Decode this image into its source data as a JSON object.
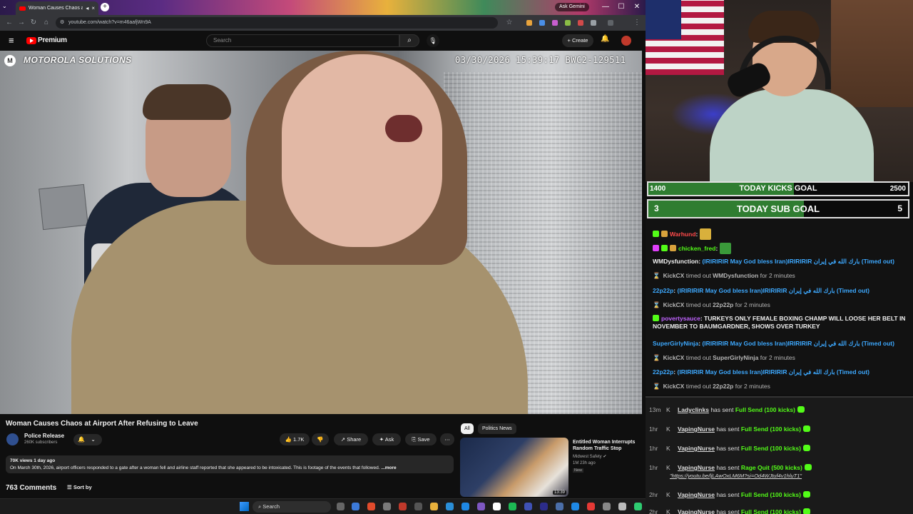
{
  "browser": {
    "tab_title": "Woman Causes Chaos at A",
    "url": "youtube.com/watch?v=m46aafjWn9A",
    "ask_gemini": "Ask Gemini",
    "new_tab": "+",
    "tab_close": "×",
    "win_min": "—",
    "win_max": "☐",
    "win_close": "✕"
  },
  "youtube": {
    "brand": "Premium",
    "search_placeholder": "Search",
    "create_label": "+ Create",
    "video": {
      "overlay_brand": "MOTOROLA SOLUTIONS",
      "timestamp": "03/30/2026 15:39:17 BWC2-129511"
    },
    "title": "Woman Causes Chaos at Airport After Refusing to Leave",
    "channel": {
      "name": "Police Release",
      "subscribers": "260K subscribers"
    },
    "actions": {
      "likes": "1.7K",
      "share": "Share",
      "ask": "Ask",
      "save": "Save"
    },
    "description": {
      "meta": "70K views  1 day ago",
      "text": "On March 30th, 2026, airport officers responded to a gate after a woman fell and airline staff reported that she appeared to be intoxicated. This is footage of the events that followed.",
      "more": " ...more"
    },
    "comments": {
      "count": "763 Comments",
      "sort_label": "Sort by"
    },
    "chips": [
      "All",
      "Politics News"
    ],
    "recommended": {
      "title": "Entitled Woman Interrupts Random Traffic Stop",
      "channel": "Midwest Safety",
      "views": "1M  23h ago",
      "badge": "New",
      "duration": "13:39"
    }
  },
  "taskbar": {
    "search_label": "Search"
  },
  "stream": {
    "kicks_goal": {
      "label": "TODAY KICKS GOAL",
      "current": "1400",
      "target": "2500",
      "progress": 0.56
    },
    "sub_goal": {
      "label": "TODAY SUB GOAL",
      "current": "3",
      "target": "5",
      "progress": 0.6
    },
    "chat": [
      {
        "user": "Warhund",
        "user_color": "#ff4a4a",
        "sep": ":",
        "text": ""
      },
      {
        "user": "chicken_fred",
        "user_color": "#53fc18",
        "sep": ":",
        "text": ""
      },
      {
        "user": "WMDysfunction",
        "user_color": "#ffffff",
        "sep": ":",
        "text": "(IRIRIRIR May God bless Iran)IRIRIRIR بارك الله في إيران (Timed out)"
      },
      {
        "user": "KickCX",
        "sys": "timed out",
        "target": "WMDysfunction",
        "tail": "for 2 minutes"
      },
      {
        "user": "22p22p",
        "user_color": "#3da9ff",
        "sep": ":",
        "text": "(IRIRIRIR May God bless Iran)IRIRIRIR بارك الله في إيران (Timed out)"
      },
      {
        "user": "KickCX",
        "sys": "timed out",
        "target": "22p22p",
        "tail": "for 2 minutes"
      },
      {
        "user": "povertysauce",
        "user_color": "#c063ff",
        "sep": ":",
        "text": "TURKEYS ONLY FEMALE BOXING CHAMP WILL LOOSE HER BELT IN NOVEMBER TO BAUMGARDNER, SHOWS OVER TURKEY"
      },
      {
        "user": "SuperGirlyNinja",
        "user_color": "#3da9ff",
        "sep": ":",
        "text": "(IRIRIRIR May God bless Iran)IRIRIRIR بارك الله في إيران (Timed out)"
      },
      {
        "user": "KickCX",
        "sys": "timed out",
        "target": "SuperGirlyNinja",
        "tail": "for 2 minutes"
      },
      {
        "user": "22p22p",
        "user_color": "#3da9ff",
        "sep": ":",
        "text": "(IRIRIRIR May God bless Iran)IRIRIRIR بارك الله في إيران (Timed out)"
      },
      {
        "user": "KickCX",
        "sys": "timed out",
        "target": "22p22p",
        "tail": "for 2 minutes"
      }
    ],
    "events": [
      {
        "time": "13m",
        "user": "Ladyclinks",
        "verb": "has sent",
        "action": "Full Send (100 kicks)"
      },
      {
        "time": "1hr",
        "user": "VapingNurse",
        "verb": "has sent",
        "action": "Full Send (100 kicks)"
      },
      {
        "time": "1hr",
        "user": "VapingNurse",
        "verb": "has sent",
        "action": "Full Send (100 kicks)"
      },
      {
        "time": "1hr",
        "user": "VapingNurse",
        "verb": "has sent",
        "action": "Rage Quit (500 kicks)",
        "link": "\"https://youtu.be/ljLAwOxLM6M?si=Od4WJtuf4v1hluT1\""
      },
      {
        "time": "2hr",
        "user": "VapingNurse",
        "verb": "has sent",
        "action": "Full Send (100 kicks)"
      },
      {
        "time": "2hr",
        "user": "VapingNurse",
        "verb": "has sent",
        "action": "Full Send (100 kicks)"
      }
    ]
  },
  "colors": {
    "yt_red": "#ff0000",
    "kick_green": "#53fc18",
    "goal_green": "#2f7d31",
    "link_blue": "#3da9ff"
  }
}
